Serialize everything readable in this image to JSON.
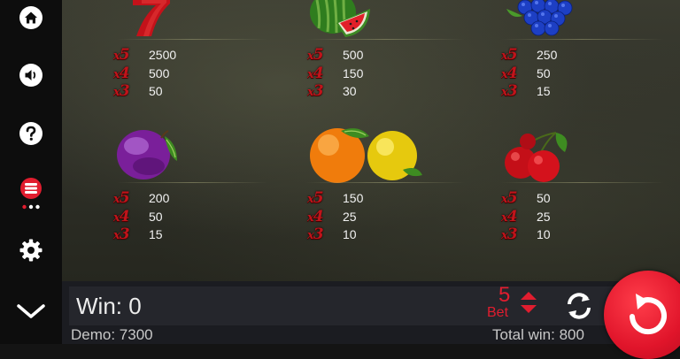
{
  "colors": {
    "accent_red": "#e11d2f",
    "multiplier_red": "#c0141b",
    "sidebar_icon": "#ffffff",
    "bottom_bar": "#1b1c21"
  },
  "sidebar": {
    "items": [
      {
        "icon": "home-icon"
      },
      {
        "icon": "sound-icon"
      },
      {
        "icon": "help-icon"
      },
      {
        "icon": "coins-icon",
        "active": true
      },
      {
        "icon": "settings-icon"
      },
      {
        "icon": "chevron-down-icon"
      }
    ]
  },
  "paytable": {
    "symbols": [
      {
        "name": "seven",
        "icon": "seven-icon",
        "rows": [
          {
            "mult": "5",
            "pay": "2500"
          },
          {
            "mult": "4",
            "pay": "500"
          },
          {
            "mult": "3",
            "pay": "50"
          }
        ]
      },
      {
        "name": "watermelon",
        "icon": "watermelon-icon",
        "rows": [
          {
            "mult": "5",
            "pay": "500"
          },
          {
            "mult": "4",
            "pay": "150"
          },
          {
            "mult": "3",
            "pay": "30"
          }
        ]
      },
      {
        "name": "grapes",
        "icon": "grapes-icon",
        "rows": [
          {
            "mult": "5",
            "pay": "250"
          },
          {
            "mult": "4",
            "pay": "50"
          },
          {
            "mult": "3",
            "pay": "15"
          }
        ]
      },
      {
        "name": "plum",
        "icon": "plum-icon",
        "rows": [
          {
            "mult": "5",
            "pay": "200"
          },
          {
            "mult": "4",
            "pay": "50"
          },
          {
            "mult": "3",
            "pay": "15"
          }
        ]
      },
      {
        "name": "orange-lemon",
        "icon": "orange-lemon-icon",
        "rows": [
          {
            "mult": "5",
            "pay": "150"
          },
          {
            "mult": "4",
            "pay": "25"
          },
          {
            "mult": "3",
            "pay": "10"
          }
        ]
      },
      {
        "name": "cherries",
        "icon": "cherries-icon",
        "rows": [
          {
            "mult": "5",
            "pay": "50"
          },
          {
            "mult": "4",
            "pay": "25"
          },
          {
            "mult": "3",
            "pay": "10"
          }
        ]
      }
    ],
    "mult_prefix": "x"
  },
  "bottom": {
    "win_label": "Win: 0",
    "bet_value": "5",
    "bet_label": "Bet",
    "demo_text": "Demo: 7300",
    "total_win_text": "Total win: 800"
  }
}
